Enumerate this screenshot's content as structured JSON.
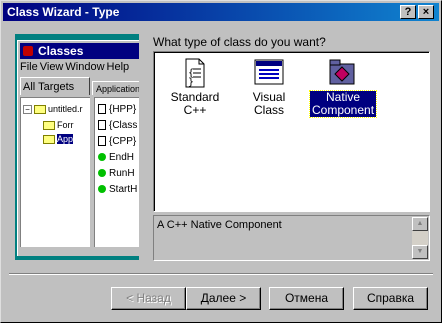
{
  "window": {
    "title": "Class Wizard - Type",
    "help_button": "?",
    "close_button": "×"
  },
  "preview": {
    "app_title": "Classes",
    "menu": [
      "File",
      "View",
      "Window",
      "Help"
    ],
    "tab_all_targets": "All Targets",
    "tab_applications": "Applications",
    "tree": {
      "root": "untitled.r",
      "child1": "Forr",
      "child2": "App"
    },
    "list": [
      "{HPP}",
      "{Class",
      "{CPP}",
      "EndH",
      "RunH",
      "StartH"
    ]
  },
  "main": {
    "question": "What type of class do you want?",
    "options": [
      {
        "label": "Standard C++",
        "icon": "source-file-icon"
      },
      {
        "label": "Visual Class",
        "icon": "visual-form-icon"
      },
      {
        "label_line1": "Native",
        "label_line2": "Component",
        "icon": "native-component-icon",
        "selected": true
      }
    ],
    "description": "A C++ Native Component"
  },
  "buttons": {
    "back": "< Назад",
    "next": "Далее >",
    "cancel": "Отмена",
    "help": "Справка"
  },
  "colors": {
    "title_bar": "#000080",
    "selection": "#000080",
    "preview_bg": "#008080"
  }
}
